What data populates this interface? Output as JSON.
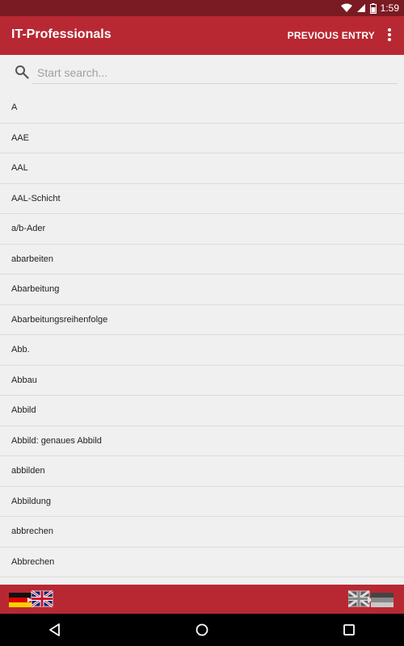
{
  "status_bar": {
    "time": "1:59",
    "icons": [
      "wifi-icon",
      "signal-icon",
      "battery-icon"
    ]
  },
  "app_bar": {
    "title": "IT-Professionals",
    "previous_entry_label": "PREVIOUS ENTRY",
    "menu_icon": "overflow-menu-icon"
  },
  "search": {
    "placeholder": "Start search...",
    "value": "",
    "icon": "search-icon"
  },
  "entries": [
    "A",
    "AAE",
    "AAL",
    "AAL-Schicht",
    "a/b-Ader",
    "abarbeiten",
    "Abarbeitung",
    "Abarbeitungsreihenfolge",
    "Abb.",
    "Abbau",
    "Abbild",
    "Abbild: genaues Abbild",
    "abbilden",
    "Abbildung",
    "abbrechen",
    "Abbrechen"
  ],
  "bottom_bar": {
    "left_button_icon": "german-english-flag-icon",
    "right_button_icon": "english-german-flag-icon"
  },
  "nav_bar": {
    "icons": [
      "back-icon",
      "home-icon",
      "recents-icon"
    ]
  },
  "colors": {
    "status_bar": "#7a1a22",
    "app_bar": "#b82833",
    "bottom_bar": "#b82833",
    "list_background": "#f0f0f0",
    "divider": "#dcdcdc"
  }
}
